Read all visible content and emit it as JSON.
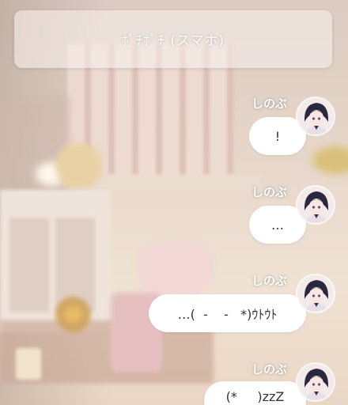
{
  "header": {
    "title": "ﾎﾟﾁﾎﾟﾁ (スマホ)"
  },
  "messages": [
    {
      "sender": "しのぶ",
      "text": "!"
    },
    {
      "sender": "しのぶ",
      "text": "…"
    },
    {
      "sender": "しのぶ",
      "text": "…(  -    -   *)ｳﾄｳﾄ"
    },
    {
      "sender": "しのぶ",
      "text": "(*     )zzZ"
    }
  ],
  "avatar_icon": "character-portrait-icon",
  "colors": {
    "bubble": "#ffffff",
    "name_text": "#ffffff",
    "header_bg": "#f5eee9"
  }
}
